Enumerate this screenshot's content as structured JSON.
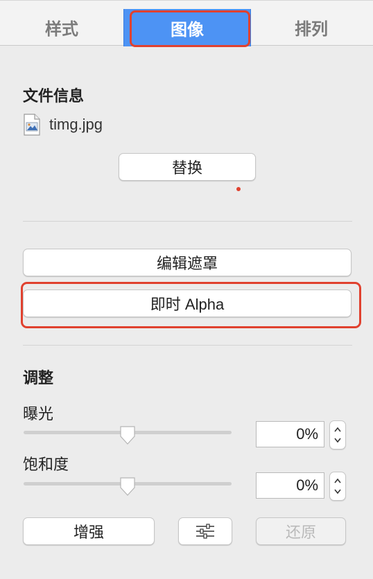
{
  "tabs": [
    {
      "label": "样式"
    },
    {
      "label": "图像"
    },
    {
      "label": "排列"
    }
  ],
  "file_info": {
    "title": "文件信息",
    "file_name": "timg.jpg",
    "replace_label": "替换"
  },
  "mask": {
    "edit_mask_label": "编辑遮罩",
    "instant_alpha_label": "即时 Alpha"
  },
  "adjust": {
    "title": "调整",
    "exposure": {
      "label": "曝光",
      "value": "0%",
      "level": 0.5
    },
    "saturation": {
      "label": "饱和度",
      "value": "0%",
      "level": 0.5
    },
    "enhance_label": "增强",
    "restore_label": "还原"
  },
  "colors": {
    "accent": "#4d93f4",
    "highlight": "#e0412f"
  }
}
